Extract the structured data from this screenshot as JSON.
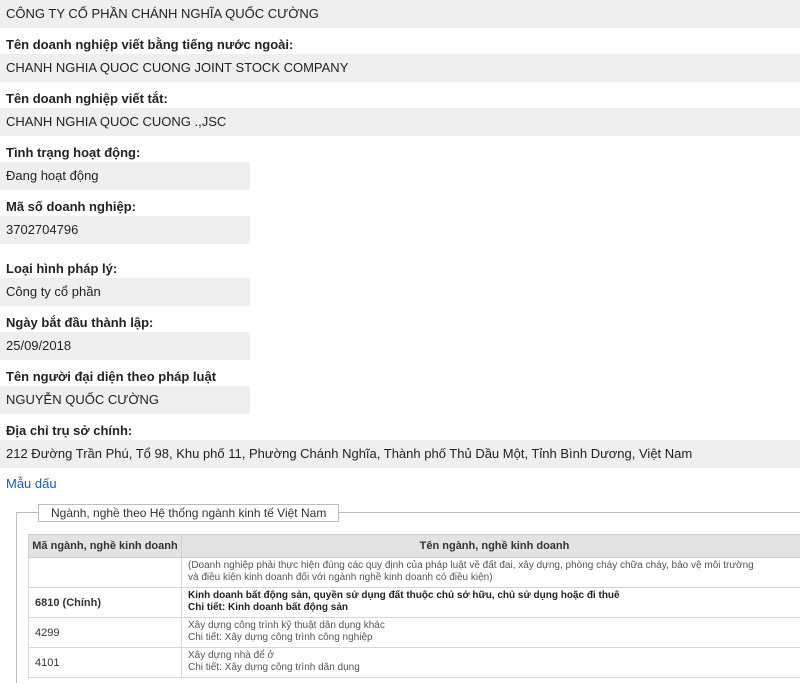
{
  "company": {
    "name": "CÔNG TY CỔ PHẦN CHÁNH NGHĨA QUỐC CƯỜNG",
    "fields": [
      {
        "label": "Tên doanh nghiệp viết bằng tiếng nước ngoài:",
        "value": "CHANH NGHIA QUOC CUONG JOINT STOCK COMPANY"
      },
      {
        "label": "Tên doanh nghiệp viết tắt:",
        "value": "CHANH NGHIA QUOC CUONG .,JSC"
      },
      {
        "label": "Tình trạng hoạt động:",
        "value": "Đang hoạt động"
      },
      {
        "label": "Mã số doanh nghiệp:",
        "value": "3702704796"
      },
      {
        "label": "Loại hình pháp lý:",
        "value": "Công ty cổ phần"
      },
      {
        "label": "Ngày bắt đầu thành lập:",
        "value": "25/09/2018"
      },
      {
        "label": "Tên người đại diện theo pháp luật",
        "value": "NGUYỄN QUỐC CƯỜNG"
      },
      {
        "label": "Địa chỉ trụ sở chính:",
        "value": "212 Đường Trần Phú, Tổ 98, Khu phố 11, Phường Chánh Nghĩa, Thành phố Thủ Dầu Một, Tỉnh Bình Dương, Việt Nam"
      }
    ]
  },
  "link": {
    "label": "Mẫu dấu"
  },
  "industries": {
    "legend": "Ngành, nghề theo Hệ thống ngành kinh tế Việt Nam",
    "headers": [
      "Mã ngành, nghề kinh doanh",
      "Tên ngành, nghề kinh doanh"
    ],
    "rows": [
      {
        "code": "",
        "lines": [
          "(Doanh nghiệp phải thực hiện đúng các quy định của pháp luật về đất đai, xây dựng, phòng cháy chữa cháy, bảo vệ môi trường",
          "và điều kiện kinh doanh đối với ngành nghề kinh doanh có điều kiện)"
        ]
      },
      {
        "code": "6810 (Chính)",
        "lines": [
          "Kinh doanh bất động sản, quyền sử dụng đất thuộc chủ sở hữu, chủ sử dụng hoặc đi thuê",
          "Chi tiết: Kinh doanh bất động sản"
        ]
      },
      {
        "code": "4299",
        "lines": [
          "Xây dựng công trình kỹ thuật dân dụng khác",
          "Chi tiết: Xây dựng công trình công nghiệp"
        ]
      },
      {
        "code": "4101",
        "lines": [
          "Xây dựng nhà để ở",
          "Chi tiết: Xây dựng công trình dân dụng"
        ]
      }
    ]
  }
}
